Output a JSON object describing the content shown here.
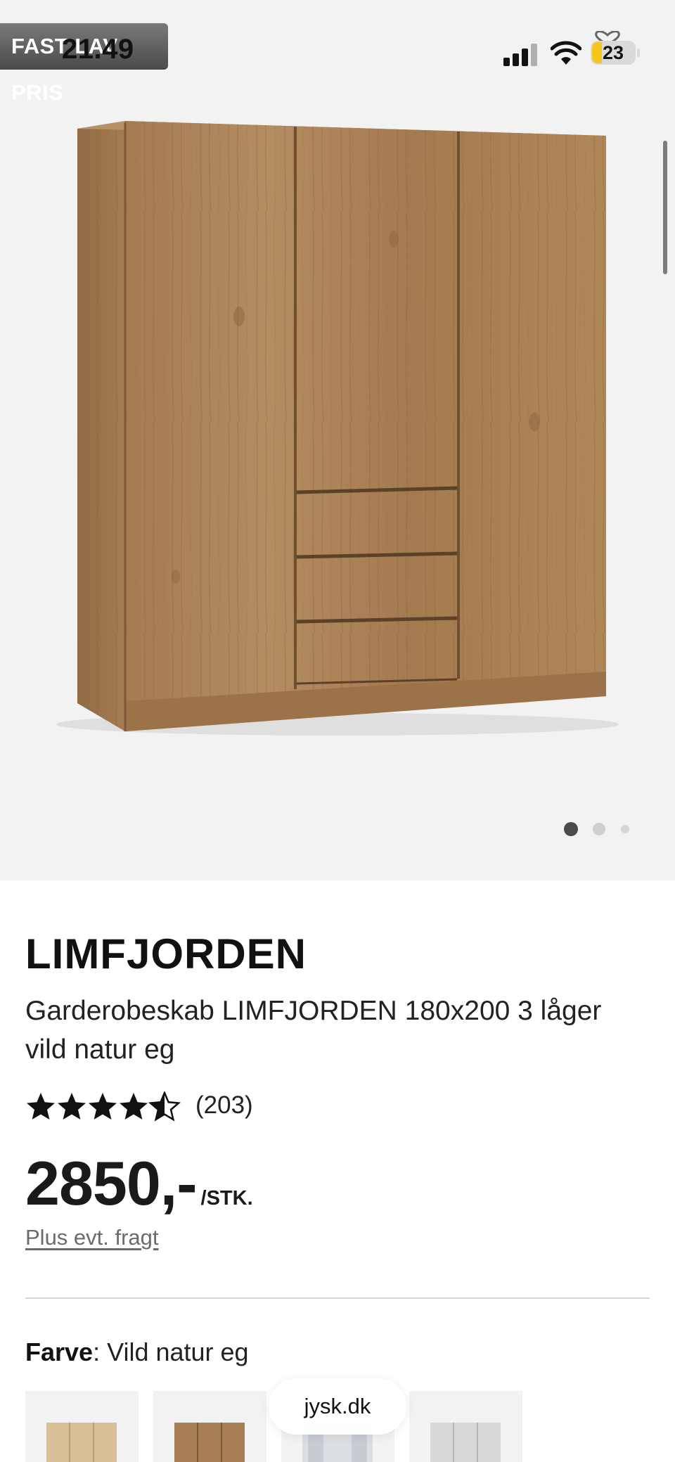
{
  "status_bar": {
    "badge": "FAST LAV PRIS",
    "time": "21.49",
    "battery_level": "23",
    "battery_color": "#f5c518"
  },
  "gallery": {
    "image": "wardrobe-3-doors-3-drawers",
    "slide_count": 3,
    "active_slide": 1
  },
  "product": {
    "brand": "LIMFJORDEN",
    "title": "Garderobeskab LIMFJORDEN 180x200 3 låger vild natur eg",
    "rating": 4.5,
    "rating_max": 5,
    "review_count": "(203)",
    "price": "2850,-",
    "price_unit": "/STK.",
    "shipping_note": "Plus evt. fragt"
  },
  "color_selector": {
    "label": "Farve",
    "separator": ": ",
    "value": "Vild natur eg",
    "swatches": [
      "light-oak",
      "wild-oak",
      "white-glass",
      "white"
    ]
  },
  "browser": {
    "url": "jysk.dk"
  },
  "colors": {
    "wood": "#a87f55",
    "wood_dark": "#8a6440",
    "hero_background": "#f2f2f2",
    "text": "#1a1a1a",
    "muted": "#6b6b6b"
  }
}
